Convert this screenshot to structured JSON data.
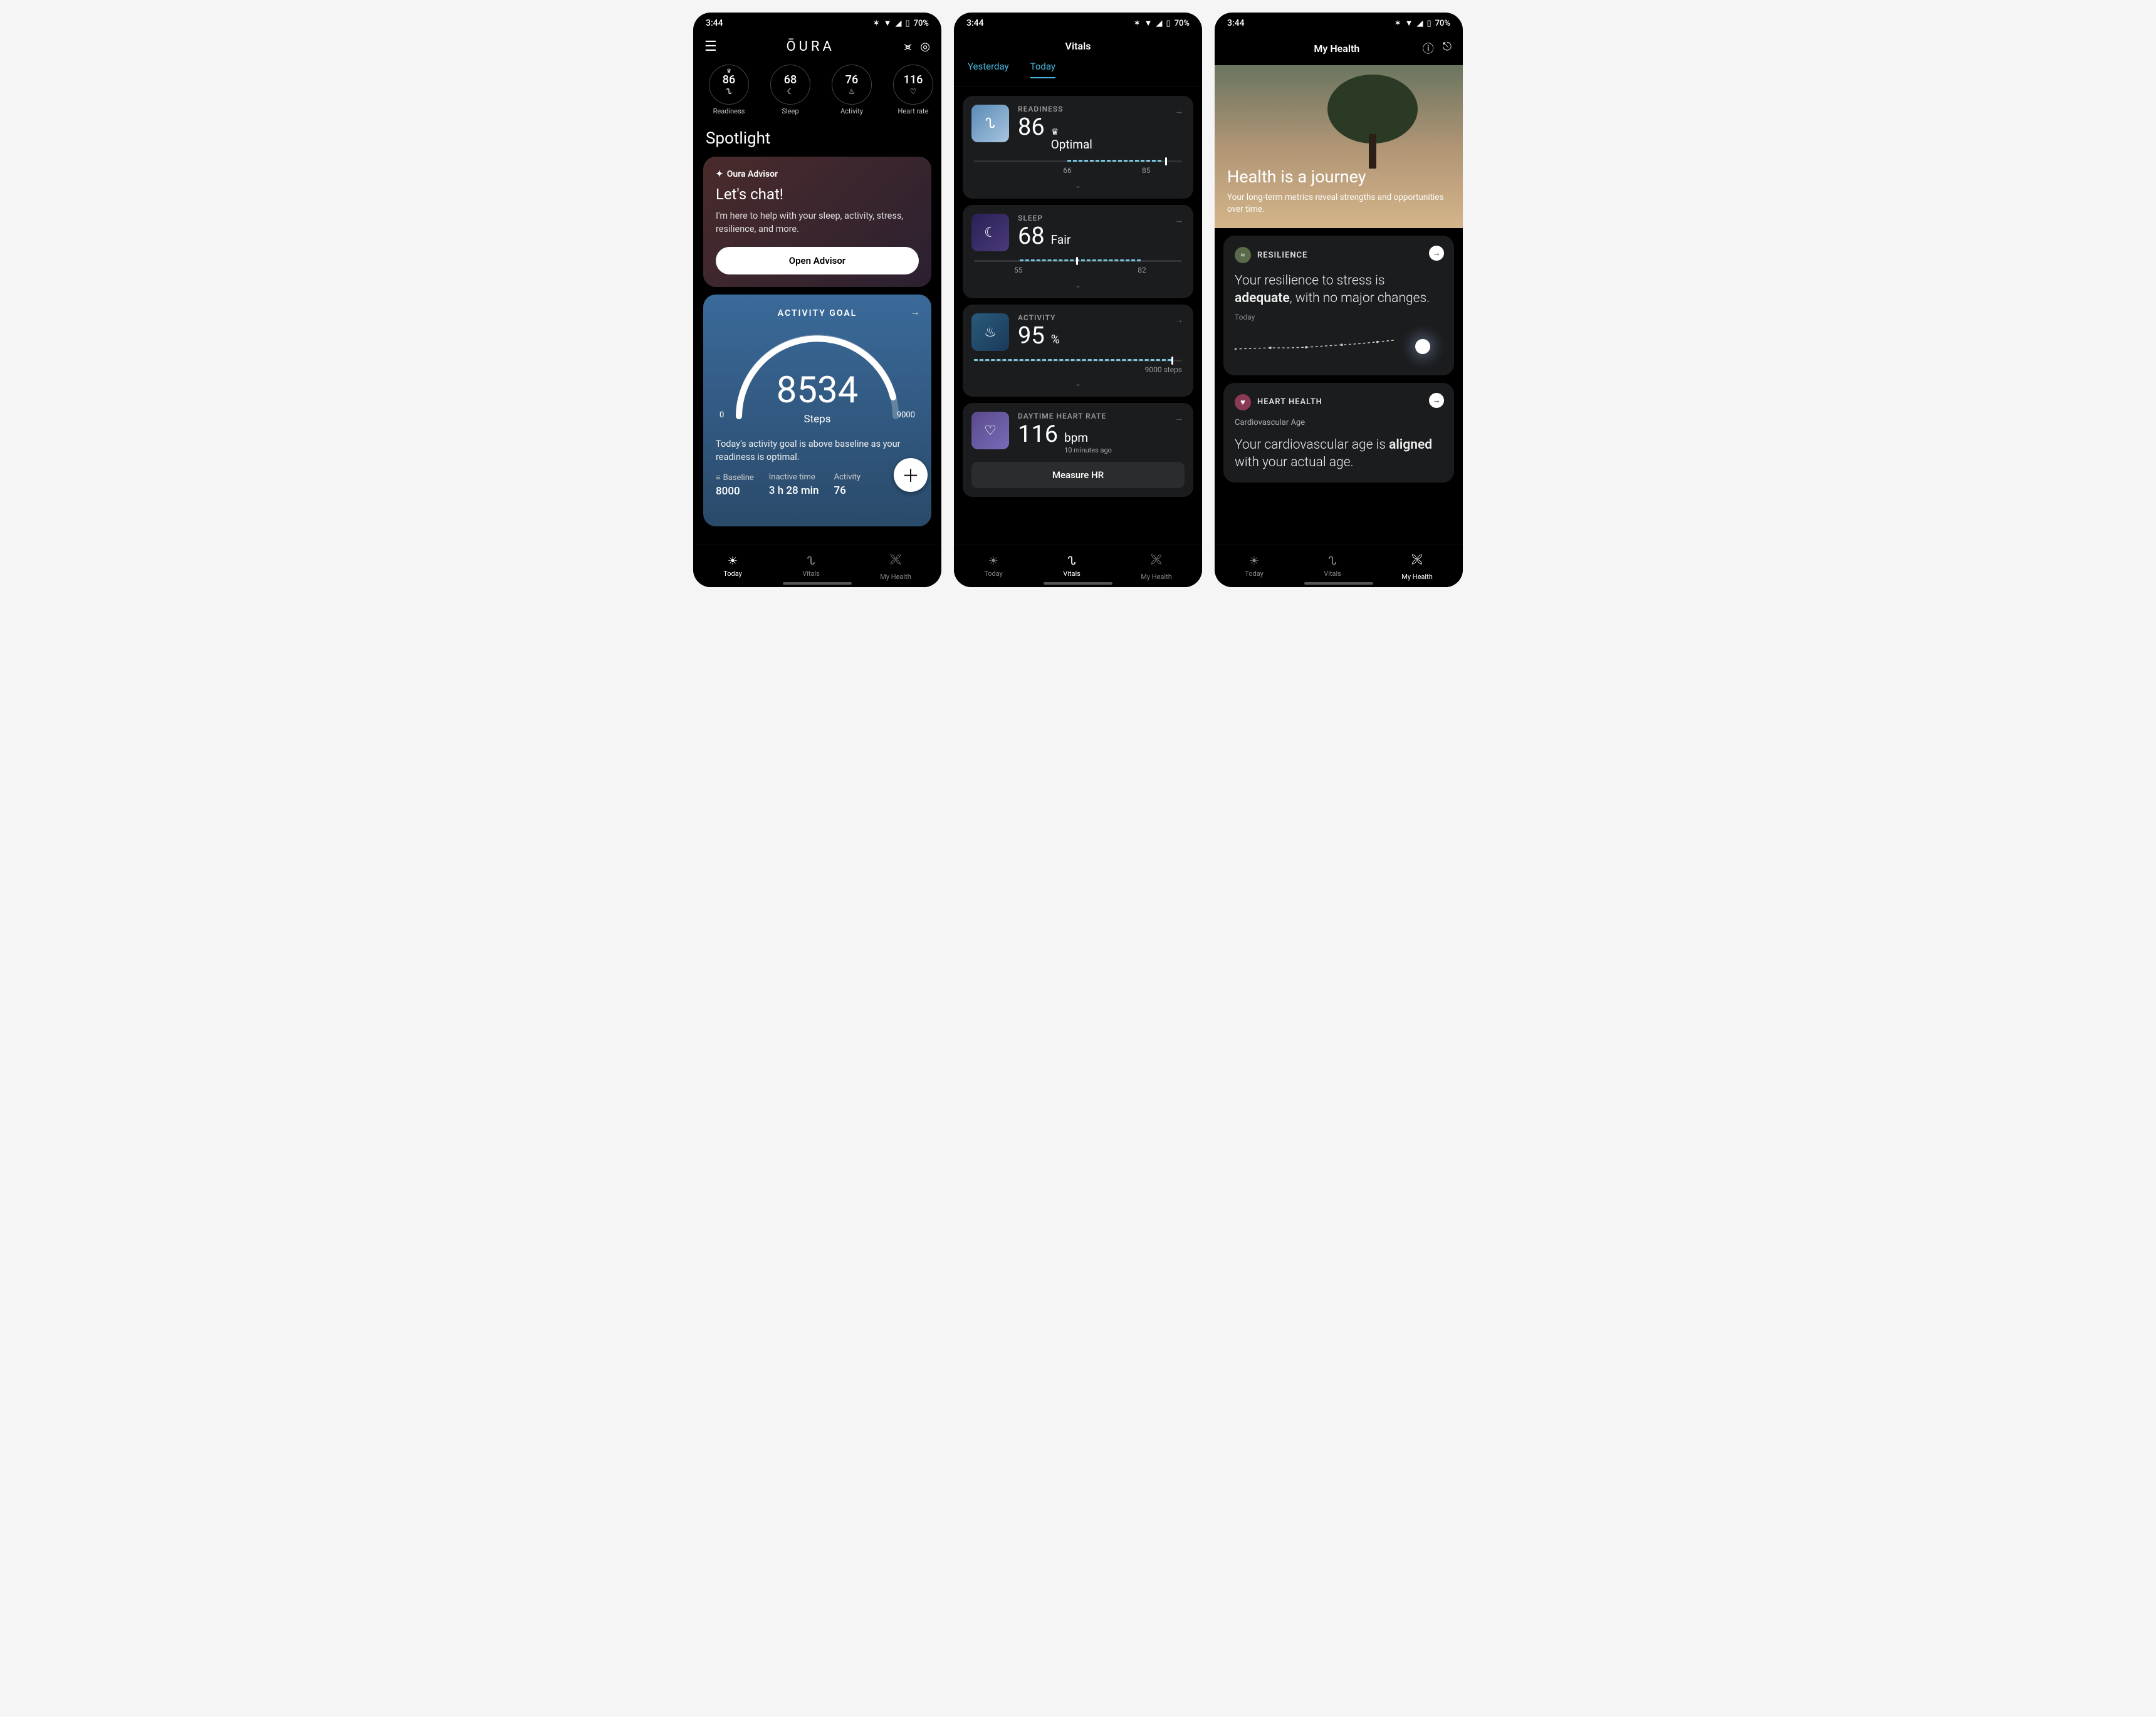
{
  "status": {
    "time": "3:44",
    "battery": "70%"
  },
  "nav": {
    "today": "Today",
    "vitals": "Vitals",
    "myhealth": "My Health"
  },
  "screen1": {
    "brand": "ŌURA",
    "rings": [
      {
        "value": "86",
        "label": "Readiness",
        "crown": true
      },
      {
        "value": "68",
        "label": "Sleep"
      },
      {
        "value": "76",
        "label": "Activity"
      },
      {
        "value": "116",
        "label": "Heart rate"
      }
    ],
    "spotlight": "Spotlight",
    "advisor": {
      "tag": "Oura Advisor",
      "headline": "Let's chat!",
      "desc": "I'm here to help with your sleep, activity, stress, resilience, and more.",
      "button": "Open Advisor"
    },
    "activity": {
      "title": "ACTIVITY GOAL",
      "value": "8534",
      "unit": "Steps",
      "min": "0",
      "max": "9000",
      "commentary": "Today's activity goal is above baseline as your readiness is optimal.",
      "stats": [
        {
          "label": "Baseline",
          "value": "8000"
        },
        {
          "label": "Inactive time",
          "value": "3 h 28 min"
        },
        {
          "label": "Activity",
          "value": "76"
        }
      ]
    }
  },
  "screen2": {
    "title": "Vitals",
    "tabs": {
      "yesterday": "Yesterday",
      "today": "Today"
    },
    "readiness": {
      "label": "READINESS",
      "score": "86",
      "status": "Optimal",
      "low": "66",
      "high": "85"
    },
    "sleep": {
      "label": "SLEEP",
      "score": "68",
      "status": "Fair",
      "low": "55",
      "high": "82"
    },
    "activity": {
      "label": "ACTIVITY",
      "score": "95",
      "pct": "%",
      "goal": "9000 steps"
    },
    "heart": {
      "label": "DAYTIME HEART RATE",
      "value": "116",
      "unit": "bpm",
      "ago": "10 minutes ago",
      "button": "Measure HR"
    }
  },
  "screen3": {
    "title": "My Health",
    "hero": {
      "title": "Health is a journey",
      "sub": "Your long-term metrics reveal strengths and opportunities over time."
    },
    "resilience": {
      "label": "RESILIENCE",
      "text_a": "Your resilience to stress is ",
      "text_b": "adequate",
      "text_c": ", with no major changes.",
      "sub": "Today"
    },
    "heart": {
      "label": "HEART HEALTH",
      "sub_small": "Cardiovascular Age",
      "text_a": "Your cardiovascular age is ",
      "text_b": "aligned",
      "text_c": " with your actual age."
    }
  }
}
